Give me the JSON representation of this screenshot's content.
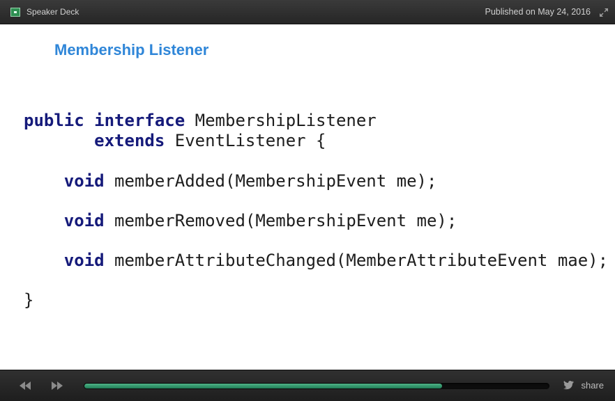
{
  "topbar": {
    "brand": "Speaker Deck",
    "published": "Published on May 24, 2016"
  },
  "slide": {
    "title": "Membership Listener",
    "code": {
      "l1_kw1": "public",
      "l1_kw2": "interface",
      "l1_rest": "MembershipListener",
      "l2_kw": "extends",
      "l2_rest": "EventListener {",
      "l3_kw": "void",
      "l3_rest": "memberAdded(MembershipEvent me);",
      "l4_kw": "void",
      "l4_rest": "memberRemoved(MembershipEvent me);",
      "l5_kw": "void",
      "l5_rest": "memberAttributeChanged(MemberAttributeEvent mae);",
      "l6": "}"
    }
  },
  "bottombar": {
    "progress": 0.77,
    "share_label": "share"
  },
  "colors": {
    "title": "#2f86d8",
    "keyword": "#151a7a",
    "progress": "#2b9a6a"
  }
}
